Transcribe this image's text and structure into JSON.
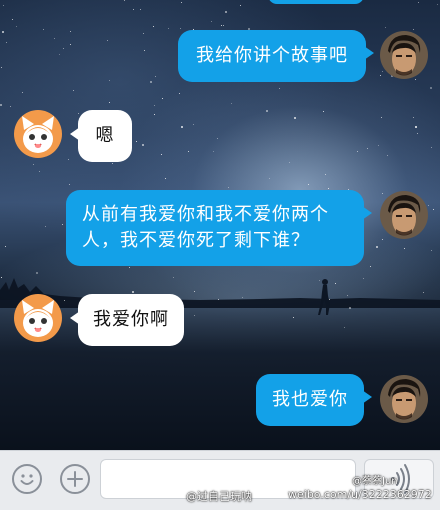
{
  "messages": [
    {
      "id": "m1",
      "side": "out",
      "lines": [
        "我给你讲个故事吧"
      ],
      "avatar": "man-avatar"
    },
    {
      "id": "m2",
      "side": "in",
      "lines": [
        "嗯"
      ],
      "avatar": "cat-avatar"
    },
    {
      "id": "m3",
      "side": "out",
      "lines": [
        "从前有我爱你和我不爱你两个",
        "人，我不爱你死了剩下谁？"
      ],
      "avatar": "man-avatar"
    },
    {
      "id": "m4",
      "side": "in",
      "lines": [
        "我爱你啊"
      ],
      "avatar": "cat-avatar"
    },
    {
      "id": "m5",
      "side": "out",
      "lines": [
        "我也爱你"
      ],
      "avatar": "man-avatar"
    }
  ],
  "bottom_bar": {
    "emoji_icon": "smiley-icon",
    "plus_icon": "plus-icon",
    "input_value": "",
    "voice_icon": "voice-wave-icon"
  },
  "watermarks": {
    "left": "@过自己玩呐",
    "right_url": "weibo.com/u/3222362972",
    "right_handle": "@蔡蔡Jun"
  },
  "colors": {
    "outgoing_bubble": "#13a1e8",
    "incoming_bubble": "#ffffff",
    "cat_avatar_bg": "#f39a4a"
  }
}
